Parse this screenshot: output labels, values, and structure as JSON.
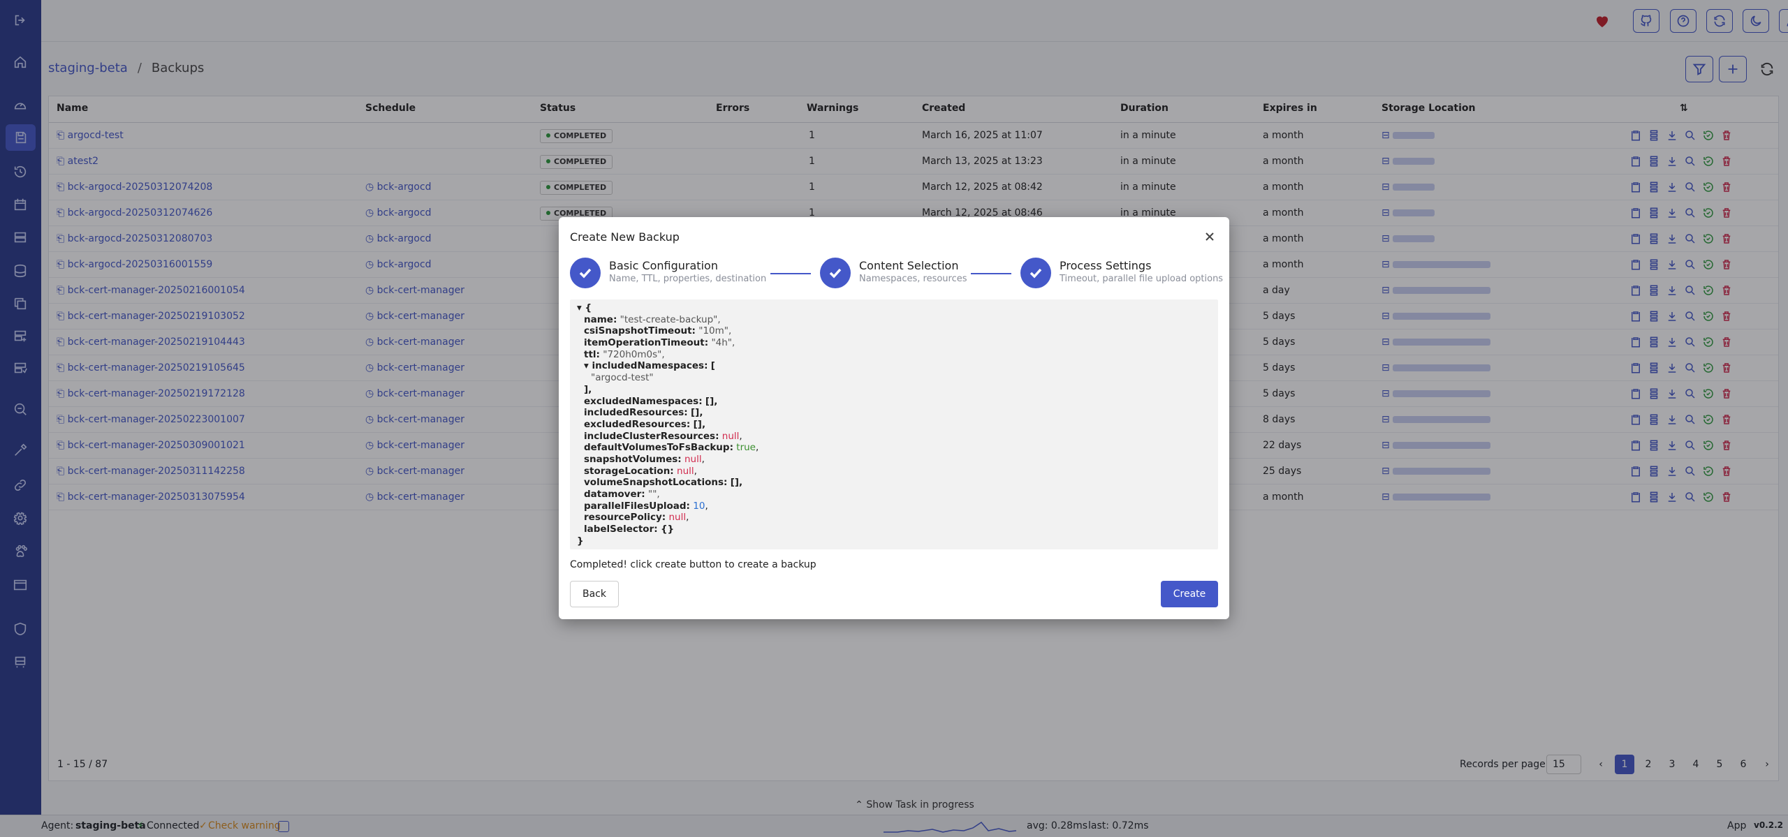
{
  "colors": {
    "primary": "#4458c9",
    "sidebar": "#2a3a8c",
    "success": "#2c9a3c",
    "danger": "#d12b4e"
  },
  "sidebar": {
    "icons": [
      "logout-icon",
      "home-icon",
      "dashboard-icon",
      "backups-icon",
      "restores-icon",
      "schedules-icon",
      "storage-icon",
      "database-icon",
      "copy-icon",
      "server-icon",
      "server-stack-icon",
      "search-icon",
      "tools-icon",
      "link-icon",
      "settings-icon",
      "pet-icon",
      "window-icon",
      "shield-icon",
      "bus-icon"
    ]
  },
  "topbar": {
    "icons": [
      "heart-icon",
      "github-icon",
      "help-icon",
      "sync-icon",
      "moon-icon",
      "user-icon"
    ]
  },
  "breadcrumb": {
    "cluster": "staging-beta",
    "separator": "/",
    "page": "Backups"
  },
  "table": {
    "columns": [
      "Name",
      "Schedule",
      "Status",
      "Errors",
      "Warnings",
      "Created",
      "Duration",
      "Expires in",
      "Storage Location"
    ],
    "rows": [
      {
        "name": "argocd-test",
        "schedule": "",
        "status": "COMPLETED",
        "warnings": "1",
        "created": "March 16, 2025 at 11:07",
        "duration": "in a minute",
        "expires": "a month"
      },
      {
        "name": "atest2",
        "schedule": "",
        "status": "COMPLETED",
        "warnings": "1",
        "created": "March 13, 2025 at 13:23",
        "duration": "in a minute",
        "expires": "a month"
      },
      {
        "name": "bck-argocd-20250312074208",
        "schedule": "bck-argocd",
        "status": "COMPLETED",
        "warnings": "1",
        "created": "March 12, 2025 at 08:42",
        "duration": "in a minute",
        "expires": "a month"
      },
      {
        "name": "bck-argocd-20250312074626",
        "schedule": "bck-argocd",
        "status": "COMPLETED",
        "warnings": "1",
        "created": "March 12, 2025 at 08:46",
        "duration": "in a minute",
        "expires": "a month"
      },
      {
        "name": "bck-argocd-20250312080703",
        "schedule": "bck-argocd",
        "status": "",
        "warnings": "",
        "created": "",
        "duration": "",
        "expires": "a month"
      },
      {
        "name": "bck-argocd-20250316001559",
        "schedule": "bck-argocd",
        "status": "",
        "warnings": "",
        "created": "",
        "duration": "",
        "expires": "a month"
      },
      {
        "name": "bck-cert-manager-20250216001054",
        "schedule": "bck-cert-manager",
        "status": "",
        "warnings": "",
        "created": "",
        "duration": "",
        "expires": "a day"
      },
      {
        "name": "bck-cert-manager-20250219103052",
        "schedule": "bck-cert-manager",
        "status": "",
        "warnings": "",
        "created": "",
        "duration": "",
        "expires": "5 days"
      },
      {
        "name": "bck-cert-manager-20250219104443",
        "schedule": "bck-cert-manager",
        "status": "",
        "warnings": "",
        "created": "",
        "duration": "",
        "expires": "5 days"
      },
      {
        "name": "bck-cert-manager-20250219105645",
        "schedule": "bck-cert-manager",
        "status": "",
        "warnings": "",
        "created": "",
        "duration": "",
        "expires": "5 days"
      },
      {
        "name": "bck-cert-manager-20250219172128",
        "schedule": "bck-cert-manager",
        "status": "",
        "warnings": "",
        "created": "",
        "duration": "",
        "expires": "5 days"
      },
      {
        "name": "bck-cert-manager-20250223001007",
        "schedule": "bck-cert-manager",
        "status": "",
        "warnings": "",
        "created": "",
        "duration": "",
        "expires": "8 days"
      },
      {
        "name": "bck-cert-manager-20250309001021",
        "schedule": "bck-cert-manager",
        "status": "",
        "warnings": "",
        "created": "",
        "duration": "",
        "expires": "22 days"
      },
      {
        "name": "bck-cert-manager-20250311142258",
        "schedule": "bck-cert-manager",
        "status": "",
        "warnings": "",
        "created": "",
        "duration": "",
        "expires": "25 days"
      },
      {
        "name": "bck-cert-manager-20250313075954",
        "schedule": "bck-cert-manager",
        "status": "",
        "warnings": "",
        "created": "",
        "duration": "",
        "expires": "a month"
      }
    ]
  },
  "pagination": {
    "range": "1 - 15 / 87",
    "records_label": "Records per page",
    "records_value": "15",
    "pages": [
      "1",
      "2",
      "3",
      "4",
      "5",
      "6"
    ],
    "current": "1",
    "prev": "‹",
    "next": "›"
  },
  "taskbar": {
    "label": "Show Task in progress"
  },
  "statusbar": {
    "agent_label": "Agent:",
    "agent_name": "staging-beta",
    "connected": "Connected",
    "check_warning": "Check warning",
    "avg": "avg: 0.28ms",
    "last": "last: 0.72ms",
    "app": "App",
    "version": "v0.2.2"
  },
  "modal": {
    "title": "Create New Backup",
    "steps": [
      {
        "title": "Basic Configuration",
        "subtitle": "Name, TTL, properties, destination"
      },
      {
        "title": "Content Selection",
        "subtitle": "Namespaces, resources"
      },
      {
        "title": "Process Settings",
        "subtitle": "Timeout, parallel file upload options"
      }
    ],
    "json": {
      "open": "▾ {",
      "name_key": "name:",
      "name_val": "\"test-create-backup\",",
      "csi_key": "csiSnapshotTimeout:",
      "csi_val": "\"10m\",",
      "item_key": "itemOperationTimeout:",
      "item_val": "\"4h\",",
      "ttl_key": "ttl:",
      "ttl_val": "\"720h0m0s\",",
      "incns_key": "▾ includedNamespaces:",
      "incns_open": "[",
      "incns_item": "\"argocd-test\"",
      "incns_close": "],",
      "exns_key": "excludedNamespaces:",
      "exns_val": "[],",
      "incres_key": "includedResources:",
      "incres_val": "[],",
      "exres_key": "excludedResources:",
      "exres_val": "[],",
      "icr_key": "includeClusterResources:",
      "icr_val": "null",
      "icr_comma": ",",
      "dvfs_key": "defaultVolumesToFsBackup:",
      "dvfs_val": "true",
      "dvfs_comma": ",",
      "snap_key": "snapshotVolumes:",
      "snap_val": "null",
      "snap_comma": ",",
      "sl_key": "storageLocation:",
      "sl_val": "null",
      "sl_comma": ",",
      "vsl_key": "volumeSnapshotLocations:",
      "vsl_val": "[],",
      "dm_key": "datamover:",
      "dm_val": "\"\",",
      "pfu_key": "parallelFilesUpload:",
      "pfu_val": "10",
      "pfu_comma": ",",
      "rp_key": "resourcePolicy:",
      "rp_val": "null",
      "rp_comma": ",",
      "ls_key": "labelSelector:",
      "ls_val": "{}",
      "close": "}"
    },
    "message": "Completed! click create button to create a backup",
    "back_label": "Back",
    "create_label": "Create"
  }
}
